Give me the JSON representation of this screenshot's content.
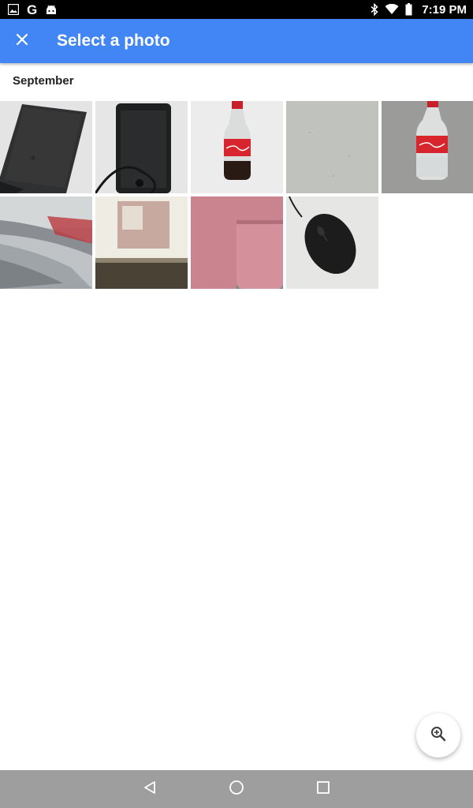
{
  "status_bar": {
    "time": "7:19 PM",
    "left_icons": [
      "image-icon",
      "google-icon",
      "android-icon"
    ],
    "right_icons": [
      "bluetooth-icon",
      "wifi-icon",
      "battery-icon"
    ],
    "google_letter": "G"
  },
  "app_bar": {
    "title": "Select a photo",
    "close_icon": "close-icon",
    "color": "#4285f4"
  },
  "section": {
    "label": "September"
  },
  "photos": [
    {
      "subject": "black phone case"
    },
    {
      "subject": "black phone with cable"
    },
    {
      "subject": "Coca-Cola bottle"
    },
    {
      "subject": "gray surface"
    },
    {
      "subject": "Coca-Cola bottle on gray"
    },
    {
      "subject": "blurred room"
    },
    {
      "subject": "wall board"
    },
    {
      "subject": "pink tray on green"
    },
    {
      "subject": "black computer mouse"
    }
  ],
  "fab": {
    "icon": "zoom-in-icon"
  },
  "nav_bar": {
    "icons": [
      "back-icon",
      "home-icon",
      "recents-icon"
    ],
    "color": "#9e9e9e"
  }
}
